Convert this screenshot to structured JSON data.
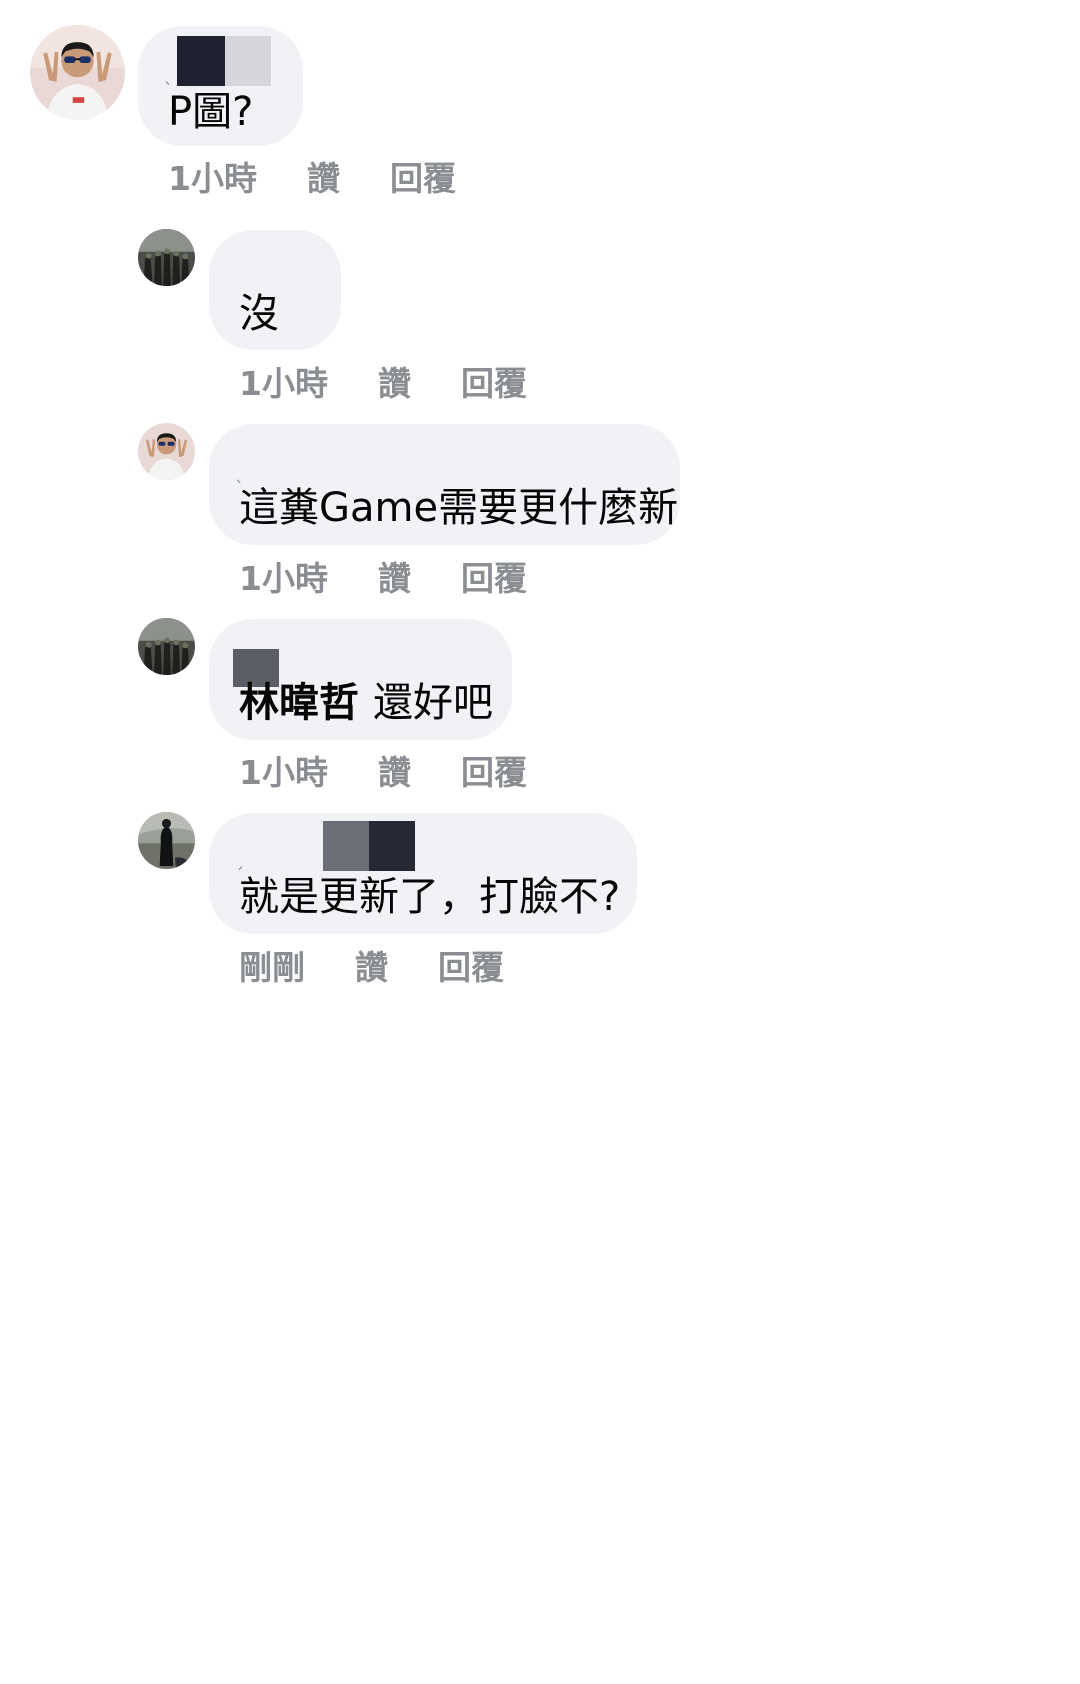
{
  "comments": [
    {
      "author": "",
      "text": "P圖?",
      "mention": "",
      "time": "1小時",
      "like_label": "讚",
      "reply_label": "回覆",
      "avatar": "avatar-peace-sign-sunglasses",
      "redact_colors": [
        "#1f2230",
        "#d4d6dc"
      ]
    },
    {
      "author": "",
      "text": "沒",
      "mention": "",
      "time": "1小時",
      "like_label": "讚",
      "reply_label": "回覆",
      "avatar": "avatar-group-photo",
      "redact_colors": []
    },
    {
      "author": "",
      "text": "這糞Game需要更什麼新",
      "mention": "",
      "time": "1小時",
      "like_label": "讚",
      "reply_label": "回覆",
      "avatar": "avatar-peace-sign-sunglasses",
      "redact_colors": []
    },
    {
      "author": "",
      "text": "還好吧",
      "mention": "林暐哲",
      "time": "1小時",
      "like_label": "讚",
      "reply_label": "回覆",
      "avatar": "avatar-group-photo",
      "redact_colors": [
        "#5b5e66"
      ]
    },
    {
      "author": "",
      "text": "就是更新了，打臉不?",
      "mention": "",
      "time": "剛剛",
      "like_label": "讚",
      "reply_label": "回覆",
      "avatar": "avatar-outdoor-person",
      "redact_colors": [
        "#6b6e76",
        "#262833"
      ]
    }
  ],
  "colors": {
    "bubble": "#f0f2f5",
    "text": "#050505",
    "meta": "#8a8d91"
  }
}
